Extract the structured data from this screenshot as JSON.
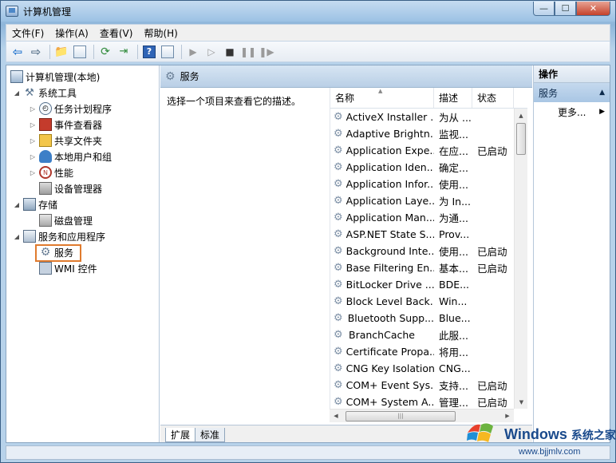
{
  "window": {
    "title": "计算机管理",
    "min_glyph": "—",
    "max_glyph": "☐",
    "close_glyph": "✕"
  },
  "menu": {
    "items": [
      "文件(F)",
      "操作(A)",
      "查看(V)",
      "帮助(H)"
    ]
  },
  "tree": {
    "root": "计算机管理(本地)",
    "system_tools": "系统工具",
    "task_scheduler": "任务计划程序",
    "event_viewer": "事件查看器",
    "shared_folders": "共享文件夹",
    "local_users": "本地用户和组",
    "performance": "性能",
    "device_manager": "设备管理器",
    "storage": "存储",
    "disk_management": "磁盘管理",
    "services_apps": "服务和应用程序",
    "services": "服务",
    "wmi": "WMI 控件"
  },
  "center": {
    "header": "服务",
    "description": "选择一个项目来查看它的描述。",
    "columns": {
      "name": "名称",
      "desc": "描述",
      "status": "状态"
    },
    "rows": [
      {
        "name": "ActiveX Installer ...",
        "desc": "为从 ...",
        "status": ""
      },
      {
        "name": "Adaptive Brightn...",
        "desc": "监视...",
        "status": ""
      },
      {
        "name": "Application Expe...",
        "desc": "在应...",
        "status": "已启动"
      },
      {
        "name": "Application Iden...",
        "desc": "确定...",
        "status": ""
      },
      {
        "name": "Application Infor...",
        "desc": "使用...",
        "status": ""
      },
      {
        "name": "Application Laye...",
        "desc": "为 In...",
        "status": ""
      },
      {
        "name": "Application Man...",
        "desc": "为通...",
        "status": ""
      },
      {
        "name": "ASP.NET State S...",
        "desc": "Prov...",
        "status": ""
      },
      {
        "name": "Background Inte...",
        "desc": "使用...",
        "status": "已启动"
      },
      {
        "name": "Base Filtering En...",
        "desc": "基本...",
        "status": "已启动"
      },
      {
        "name": "BitLocker Drive ...",
        "desc": "BDE...",
        "status": ""
      },
      {
        "name": "Block Level Back...",
        "desc": "Win...",
        "status": ""
      },
      {
        "name": "Bluetooth Supp...",
        "desc": "Blue...",
        "status": ""
      },
      {
        "name": "BranchCache",
        "desc": "此服...",
        "status": ""
      },
      {
        "name": "Certificate Propa...",
        "desc": "将用...",
        "status": ""
      },
      {
        "name": "CNG Key Isolation",
        "desc": "CNG...",
        "status": ""
      },
      {
        "name": "COM+ Event Sys...",
        "desc": "支持...",
        "status": "已启动"
      },
      {
        "name": "COM+ System A...",
        "desc": "管理...",
        "status": "已启动"
      }
    ],
    "tabs": [
      "扩展",
      "标准"
    ]
  },
  "actions": {
    "header": "操作",
    "section": "服务",
    "more": "更多..."
  },
  "watermark": {
    "brand": "Windows",
    "suffix": "系统之家",
    "url": "www.bjjmlv.com"
  }
}
